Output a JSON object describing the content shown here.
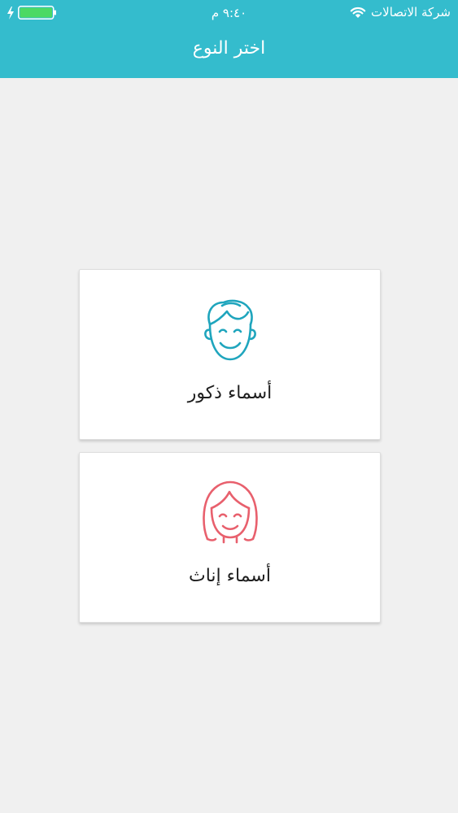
{
  "status_bar": {
    "time": "٩:٤٠ م",
    "carrier": "شركة الاتصالات",
    "battery_level": 1.0,
    "icons": [
      "charging-bolt-icon",
      "battery-icon",
      "wifi-icon"
    ]
  },
  "nav": {
    "title": "اختر النوع"
  },
  "options": {
    "male": {
      "label": "أسماء ذكور",
      "icon": "boy-face-icon",
      "color": "#1fa5bd"
    },
    "female": {
      "label": "أسماء إناث",
      "icon": "girl-face-icon",
      "color": "#e8606d"
    }
  },
  "colors": {
    "header": "#34bccd",
    "background": "#f0f0f0",
    "card": "#ffffff",
    "battery_fill": "#4cd964"
  }
}
